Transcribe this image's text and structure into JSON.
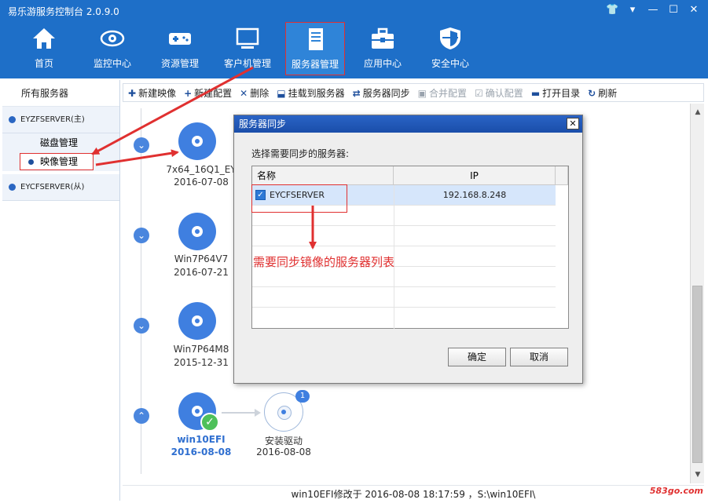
{
  "window": {
    "title": "易乐游服务控制台 2.0.9.0"
  },
  "nav": [
    {
      "label": "首页",
      "icon": "home-icon"
    },
    {
      "label": "监控中心",
      "icon": "eye-icon"
    },
    {
      "label": "资源管理",
      "icon": "gamepad-icon"
    },
    {
      "label": "客户机管理",
      "icon": "monitor-icon"
    },
    {
      "label": "服务器管理",
      "icon": "server-icon",
      "active": true
    },
    {
      "label": "应用中心",
      "icon": "toolbox-icon"
    },
    {
      "label": "安全中心",
      "icon": "shield-icon"
    }
  ],
  "sidebar": {
    "header": "所有服务器",
    "servers": [
      {
        "label": "EYZFSERVER(主)",
        "subitems": [
          "磁盘管理",
          "映像管理"
        ]
      },
      {
        "label": "EYCFSERVER(从)"
      }
    ]
  },
  "toolbar": [
    {
      "label": "新建映像",
      "icon": "add-image-icon"
    },
    {
      "label": "新建配置",
      "icon": "plus-icon"
    },
    {
      "label": "删除",
      "icon": "delete-icon"
    },
    {
      "label": "挂载到服务器",
      "icon": "mount-icon"
    },
    {
      "label": "服务器同步",
      "icon": "sync-icon"
    },
    {
      "label": "合并配置",
      "icon": "merge-icon",
      "disabled": true
    },
    {
      "label": "确认配置",
      "icon": "confirm-icon",
      "disabled": true
    },
    {
      "label": "打开目录",
      "icon": "folder-icon"
    },
    {
      "label": "刷新",
      "icon": "refresh-icon"
    }
  ],
  "images": [
    {
      "name": "7x64_16Q1_EY",
      "date": "2016-07-08"
    },
    {
      "name": "Win7P64V7",
      "date": "2016-07-21"
    },
    {
      "name": "Win7P64M8",
      "date": "2015-12-31"
    },
    {
      "name": "win10EFI",
      "date": "2016-08-08",
      "highlighted": true
    }
  ],
  "child_node": {
    "name": "安装驱动",
    "date": "2016-08-08",
    "badge": "1"
  },
  "status": "win10EFI修改于 2016-08-08 18:17:59 ，S:\\win10EFI\\",
  "watermark": "583go.com",
  "dialog": {
    "title": "服务器同步",
    "close": "✕",
    "prompt": "选择需要同步的服务器:",
    "columns": [
      "名称",
      "IP"
    ],
    "rows": [
      {
        "name": "EYCFSERVER",
        "ip": "192.168.8.248",
        "checked": true
      }
    ],
    "annotation": "需要同步镜像的服务器列表",
    "ok": "确定",
    "cancel": "取消"
  },
  "colors": {
    "nav_bg": "#1e6fc8",
    "accent": "#3f7fe0",
    "annotation_red": "#e03030",
    "check_green": "#4ec05a"
  }
}
